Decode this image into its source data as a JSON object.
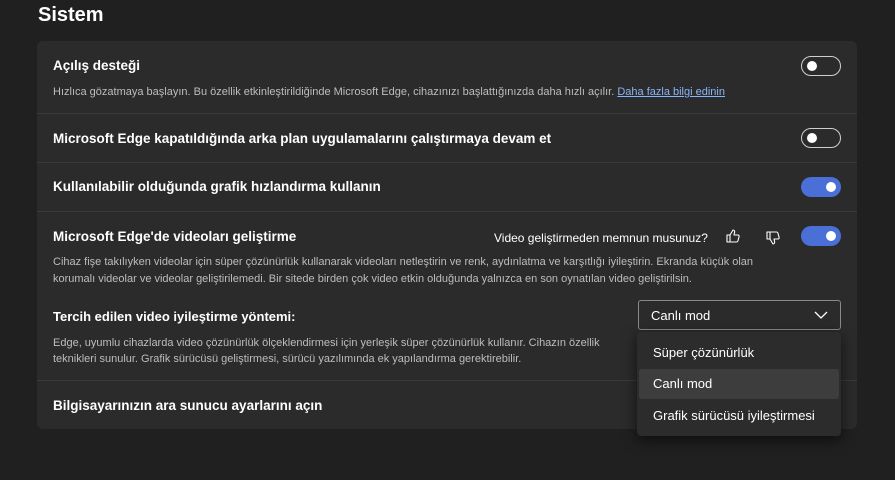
{
  "page": {
    "title": "Sistem"
  },
  "startup_boost": {
    "title": "Açılış desteği",
    "description": "Hızlıca gözatmaya başlayın. Bu özellik etkinleştirildiğinde Microsoft Edge, cihazınızı başlattığınızda daha hızlı açılır.",
    "link": "Daha fazla bilgi edinin",
    "enabled": false
  },
  "background_apps": {
    "title": "Microsoft Edge kapatıldığında arka plan uygulamalarını çalıştırmaya devam et",
    "enabled": false
  },
  "hardware_accel": {
    "title": "Kullanılabilir olduğunda grafik hızlandırma kullanın",
    "enabled": true
  },
  "video_enhance": {
    "title": "Microsoft Edge'de videoları geliştirme",
    "feedback_question": "Video geliştirmeden memnun musunuz?",
    "description_line1": "Cihaz fişe takılıyken videolar için süper çözünürlük kullanarak videoları netleştirin ve renk, aydınlatma ve karşıtlığı iyileştirin. Ekranda küçük olan",
    "description_line2": "korumalı videolar ve videolar geliştirilemedi. Bir sitede birden çok video etkin olduğunda yalnızca en son oynatılan video geliştirilsin.",
    "enabled": true,
    "icons": [
      "thumbs-up-icon",
      "thumbs-down-icon"
    ]
  },
  "preferred_method": {
    "title": "Tercih edilen video iyileştirme yöntemi:",
    "selected": "Canlı mod",
    "description_line1": "Edge, uyumlu cihazlarda video çözünürlük ölçeklendirmesi için yerleşik süper çözünürlük kullanır. Cihazın özellik",
    "description_line2": "teknikleri sunulur. Grafik sürücüsü geliştirmesi, sürücü yazılımında ek yapılandırma gerektirebilir.",
    "options": [
      "Süper çözünürlük",
      "Canlı mod",
      "Grafik sürücüsü iyileştirmesi"
    ]
  },
  "proxy": {
    "title": "Bilgisayarınızın ara sunucu ayarlarını açın"
  },
  "colors": {
    "accent": "#4a6fd6",
    "background": "#202020",
    "card": "#2b2b2b",
    "link": "#8ab4f8"
  }
}
